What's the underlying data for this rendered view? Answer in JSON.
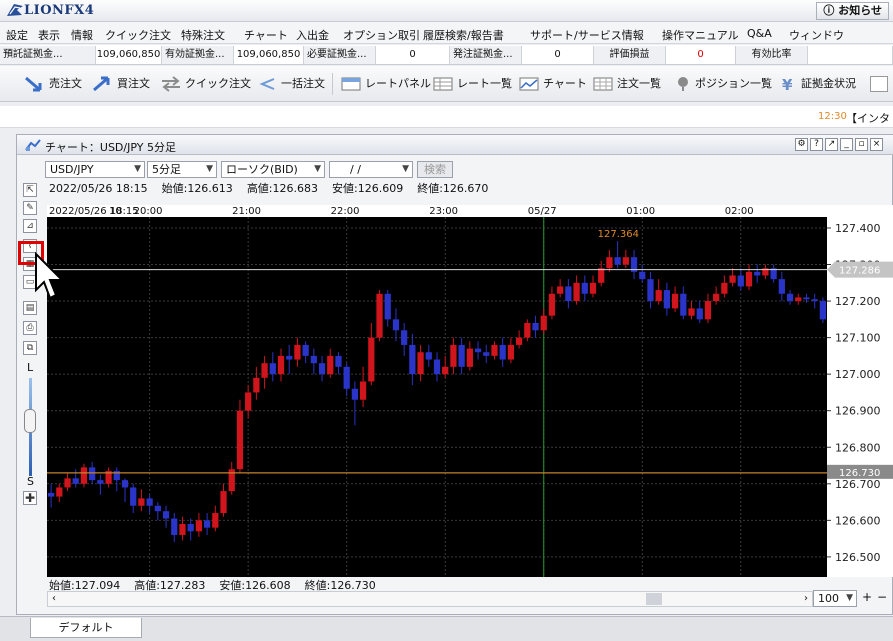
{
  "app": {
    "logo_text": "LIONFX4",
    "notice_button": "お知らせ"
  },
  "menu": [
    "設定",
    "表示",
    "情報",
    "クイック注文",
    "特殊注文",
    "チャート",
    "入出金",
    "オプション取引",
    "履歴検索/報告書",
    "サポート/サービス情報",
    "操作マニュアル",
    "Q&A",
    "ウィンドウ"
  ],
  "margin_bar": {
    "deposit_label": "預託証拠金...",
    "deposit_value": "109,060,850",
    "effective_label": "有効証拠金...",
    "effective_value": "109,060,850",
    "required_label": "必要証拠金...",
    "required_value": "0",
    "order_label": "発注証拠金...",
    "order_value": "0",
    "pl_label": "評価損益",
    "pl_value": "0",
    "ratio_label": "有効比率",
    "pl_color": "#e00000"
  },
  "toolbar": {
    "sell": "売注文",
    "buy": "買注文",
    "quick": "クイック注文",
    "batch": "一括注文",
    "rate_panel": "レートパネル",
    "rate_list": "レート一覧",
    "chart": "チャート",
    "order_list": "注文一覧",
    "position_list": "ポジション一覧",
    "margin_status": "証拠金状況"
  },
  "news": {
    "time": "12:30",
    "text": "【インタ"
  },
  "chart_window": {
    "title": "チャート：USD/JPY 5分足",
    "pair": "USD/JPY",
    "timeframe": "5分足",
    "chart_type": "ローソク(BID)",
    "date_value": "/ /",
    "search_button": "検索",
    "info_top": {
      "datetime": "2022/05/26 18:15",
      "open": "始値:126.613",
      "high": "高値:126.683",
      "low": "安値:126.609",
      "close": "終値:126.670"
    },
    "info_bottom": {
      "open": "始値:127.094",
      "high": "高値:127.283",
      "low": "安値:126.608",
      "close": "終値:126.730"
    },
    "zoom": "100",
    "left_labels": {
      "large": "L",
      "small": "S"
    }
  },
  "footer": {
    "tab": "デフォルト"
  },
  "chart_data": {
    "type": "candlestick",
    "x_labels": [
      "2022/05/26 18:15",
      "20:00",
      "21:00",
      "22:00",
      "23:00",
      "05/27",
      "01:00",
      "02:00"
    ],
    "x_label_first_short": "10",
    "y_ticks": [
      127.4,
      127.3,
      127.2,
      127.1,
      127.0,
      126.9,
      126.8,
      126.7,
      126.6,
      126.5
    ],
    "ylim": [
      126.445,
      127.43
    ],
    "max_marker": "127.364",
    "crosshair_price": "127.286",
    "current_price": "126.730",
    "colors": {
      "up": "#d0151c",
      "down": "#2a34c8",
      "bg": "#000000",
      "grid": "#3a3a3a",
      "current_line": "#c8822a",
      "crosshair": "#d8d8d8",
      "vline": "#1c9a2c",
      "max_label": "#e08a2a"
    },
    "candles": [
      [
        126.675,
        126.665,
        126.7,
        126.635
      ],
      [
        126.665,
        126.69,
        126.7,
        126.65
      ],
      [
        126.69,
        126.715,
        126.73,
        126.68
      ],
      [
        126.715,
        126.7,
        126.74,
        126.69
      ],
      [
        126.7,
        126.745,
        126.755,
        126.69
      ],
      [
        126.745,
        126.71,
        126.76,
        126.7
      ],
      [
        126.71,
        126.7,
        126.725,
        126.67
      ],
      [
        126.7,
        126.735,
        126.745,
        126.69
      ],
      [
        126.735,
        126.71,
        126.745,
        126.68
      ],
      [
        126.71,
        126.69,
        126.715,
        126.65
      ],
      [
        126.69,
        126.64,
        126.7,
        126.62
      ],
      [
        126.64,
        126.66,
        126.685,
        126.625
      ],
      [
        126.66,
        126.64,
        126.67,
        126.62
      ],
      [
        126.64,
        126.625,
        126.65,
        126.6
      ],
      [
        126.625,
        126.605,
        126.64,
        126.58
      ],
      [
        126.605,
        126.56,
        126.62,
        126.54
      ],
      [
        126.56,
        126.59,
        126.61,
        126.545
      ],
      [
        126.59,
        126.57,
        126.605,
        126.545
      ],
      [
        126.57,
        126.6,
        126.62,
        126.555
      ],
      [
        126.6,
        126.58,
        126.62,
        126.56
      ],
      [
        126.58,
        126.62,
        126.64,
        126.57
      ],
      [
        126.62,
        126.68,
        126.7,
        126.61
      ],
      [
        126.68,
        126.74,
        126.76,
        126.67
      ],
      [
        126.74,
        126.9,
        126.93,
        126.73
      ],
      [
        126.9,
        126.95,
        126.97,
        126.88
      ],
      [
        126.95,
        126.99,
        127.02,
        126.93
      ],
      [
        126.99,
        127.03,
        127.05,
        126.96
      ],
      [
        127.03,
        127.0,
        127.06,
        126.98
      ],
      [
        127.0,
        127.05,
        127.07,
        126.98
      ],
      [
        127.05,
        127.04,
        127.08,
        127.0
      ],
      [
        127.04,
        127.08,
        127.1,
        127.02
      ],
      [
        127.08,
        127.05,
        127.09,
        127.03
      ],
      [
        127.05,
        127.03,
        127.07,
        127.0
      ],
      [
        127.03,
        127.0,
        127.05,
        126.98
      ],
      [
        127.0,
        127.05,
        127.07,
        126.99
      ],
      [
        127.05,
        127.02,
        127.06,
        127.0
      ],
      [
        127.02,
        126.96,
        127.03,
        126.94
      ],
      [
        126.96,
        126.93,
        126.98,
        126.86
      ],
      [
        126.93,
        126.98,
        127.02,
        126.91
      ],
      [
        126.98,
        127.1,
        127.14,
        126.97
      ],
      [
        127.1,
        127.22,
        127.23,
        127.09
      ],
      [
        127.22,
        127.15,
        127.23,
        127.13
      ],
      [
        127.15,
        127.12,
        127.18,
        127.09
      ],
      [
        127.12,
        127.08,
        127.14,
        127.05
      ],
      [
        127.08,
        127.0,
        127.11,
        126.97
      ],
      [
        127.0,
        127.06,
        127.08,
        126.98
      ],
      [
        127.06,
        127.04,
        127.08,
        127.02
      ],
      [
        127.04,
        127.0,
        127.06,
        126.98
      ],
      [
        127.0,
        127.02,
        127.05,
        126.99
      ],
      [
        127.02,
        127.08,
        127.1,
        127.0
      ],
      [
        127.08,
        127.02,
        127.1,
        127.0
      ],
      [
        127.02,
        127.07,
        127.09,
        127.01
      ],
      [
        127.07,
        127.06,
        127.09,
        127.04
      ],
      [
        127.06,
        127.05,
        127.08,
        127.03
      ],
      [
        127.05,
        127.08,
        127.09,
        127.04
      ],
      [
        127.08,
        127.04,
        127.1,
        127.02
      ],
      [
        127.04,
        127.08,
        127.1,
        127.03
      ],
      [
        127.08,
        127.1,
        127.12,
        127.07
      ],
      [
        127.1,
        127.14,
        127.15,
        127.09
      ],
      [
        127.14,
        127.12,
        127.16,
        127.1
      ],
      [
        127.12,
        127.16,
        127.18,
        127.11
      ],
      [
        127.16,
        127.22,
        127.24,
        127.15
      ],
      [
        127.22,
        127.24,
        127.26,
        127.21
      ],
      [
        127.24,
        127.2,
        127.26,
        127.18
      ],
      [
        127.2,
        127.25,
        127.27,
        127.19
      ],
      [
        127.25,
        127.22,
        127.27,
        127.2
      ],
      [
        127.22,
        127.25,
        127.27,
        127.21
      ],
      [
        127.25,
        127.29,
        127.31,
        127.24
      ],
      [
        127.29,
        127.32,
        127.34,
        127.28
      ],
      [
        127.32,
        127.3,
        127.364,
        127.29
      ],
      [
        127.3,
        127.32,
        127.34,
        127.29
      ],
      [
        127.32,
        127.28,
        127.34,
        127.26
      ],
      [
        127.28,
        127.26,
        127.3,
        127.25
      ],
      [
        127.26,
        127.2,
        127.28,
        127.18
      ],
      [
        127.2,
        127.23,
        127.26,
        127.19
      ],
      [
        127.23,
        127.18,
        127.25,
        127.16
      ],
      [
        127.18,
        127.22,
        127.24,
        127.17
      ],
      [
        127.22,
        127.16,
        127.24,
        127.15
      ],
      [
        127.16,
        127.18,
        127.2,
        127.15
      ],
      [
        127.18,
        127.15,
        127.2,
        127.14
      ],
      [
        127.15,
        127.2,
        127.22,
        127.14
      ],
      [
        127.2,
        127.22,
        127.24,
        127.19
      ],
      [
        127.22,
        127.25,
        127.27,
        127.21
      ],
      [
        127.25,
        127.27,
        127.29,
        127.24
      ],
      [
        127.27,
        127.24,
        127.29,
        127.23
      ],
      [
        127.24,
        127.28,
        127.3,
        127.23
      ],
      [
        127.28,
        127.27,
        127.3,
        127.25
      ],
      [
        127.27,
        127.29,
        127.3,
        127.26
      ],
      [
        127.29,
        127.26,
        127.3,
        127.25
      ],
      [
        127.26,
        127.22,
        127.28,
        127.2
      ],
      [
        127.22,
        127.2,
        127.23,
        127.19
      ],
      [
        127.2,
        127.21,
        127.22,
        127.19
      ],
      [
        127.21,
        127.205,
        127.22,
        127.195
      ],
      [
        127.205,
        127.2,
        127.22,
        127.18
      ],
      [
        127.2,
        127.15,
        127.21,
        127.14
      ]
    ]
  }
}
